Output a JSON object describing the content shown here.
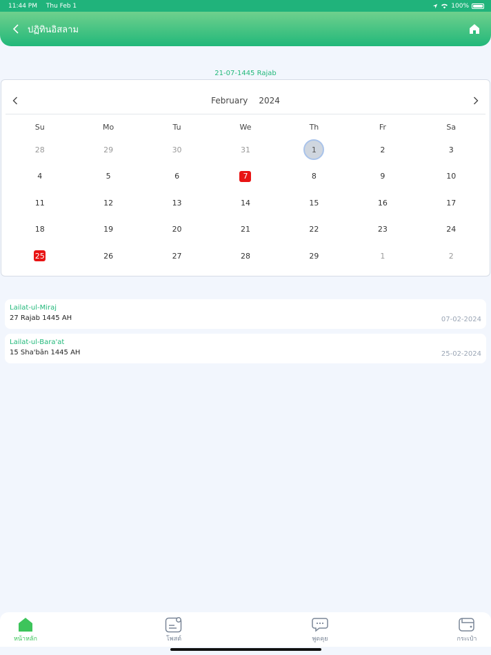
{
  "status": {
    "time": "11:44 PM",
    "date": "Thu Feb 1",
    "battery": "100%"
  },
  "header": {
    "title": "ปฏิทินอิสลาม"
  },
  "hijri_date": "21-07-1445 Rajab",
  "calendar": {
    "month": "February",
    "year": "2024",
    "weekdays": [
      "Su",
      "Mo",
      "Tu",
      "We",
      "Th",
      "Fr",
      "Sa"
    ],
    "weeks": [
      [
        {
          "d": "28",
          "muted": true
        },
        {
          "d": "29",
          "muted": true
        },
        {
          "d": "30",
          "muted": true
        },
        {
          "d": "31",
          "muted": true
        },
        {
          "d": "1",
          "today": true
        },
        {
          "d": "2"
        },
        {
          "d": "3"
        }
      ],
      [
        {
          "d": "4"
        },
        {
          "d": "5"
        },
        {
          "d": "6"
        },
        {
          "d": "7",
          "holiday": true
        },
        {
          "d": "8"
        },
        {
          "d": "9"
        },
        {
          "d": "10"
        }
      ],
      [
        {
          "d": "11"
        },
        {
          "d": "12"
        },
        {
          "d": "13"
        },
        {
          "d": "14"
        },
        {
          "d": "15"
        },
        {
          "d": "16"
        },
        {
          "d": "17"
        }
      ],
      [
        {
          "d": "18"
        },
        {
          "d": "19"
        },
        {
          "d": "20"
        },
        {
          "d": "21"
        },
        {
          "d": "22"
        },
        {
          "d": "23"
        },
        {
          "d": "24"
        }
      ],
      [
        {
          "d": "25",
          "holiday": true
        },
        {
          "d": "26"
        },
        {
          "d": "27"
        },
        {
          "d": "28"
        },
        {
          "d": "29"
        },
        {
          "d": "1",
          "muted": true
        },
        {
          "d": "2",
          "muted": true
        }
      ]
    ]
  },
  "events": [
    {
      "name": "Lailat-ul-Miraj",
      "hijri": "27 Rajab 1445 AH",
      "gregorian": "07-02-2024"
    },
    {
      "name": "Lailat-ul-Bara'at",
      "hijri": "15 Sha'bān 1445 AH",
      "gregorian": "25-02-2024"
    }
  ],
  "tabs": [
    {
      "label": "หน้าหลัก",
      "icon": "home-icon",
      "active": true
    },
    {
      "label": "โพสต์",
      "icon": "post-icon"
    },
    {
      "label": "พูดคุย",
      "icon": "chat-icon"
    },
    {
      "label": "กระเป๋า",
      "icon": "wallet-icon"
    }
  ],
  "colors": {
    "accent": "#22b87a",
    "holiday": "#e81414",
    "tab_active": "#3dc45b"
  }
}
